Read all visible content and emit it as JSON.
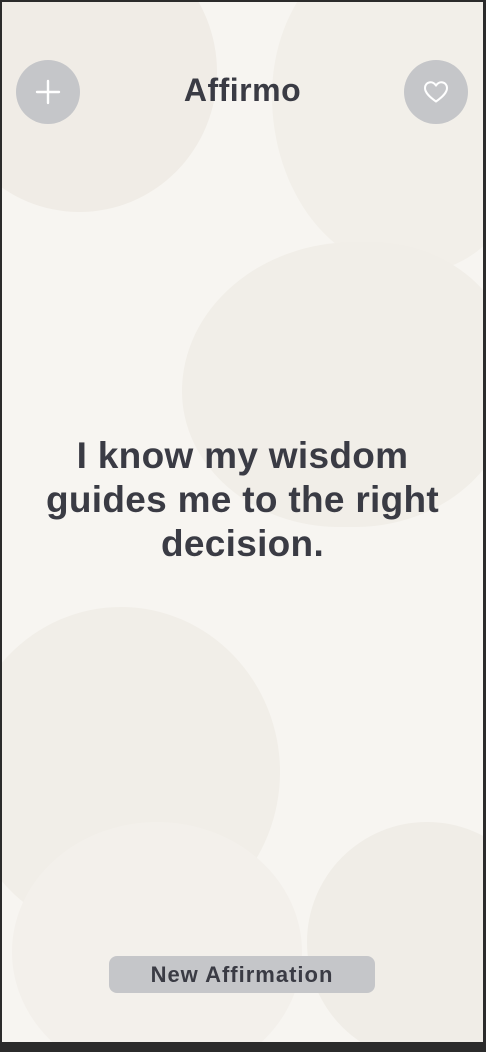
{
  "app": {
    "title": "Affirmo"
  },
  "header": {
    "add_icon": "plus-icon",
    "favorites_icon": "heart-icon"
  },
  "main": {
    "affirmation_text": "I know my wisdom guides me to the right decision."
  },
  "footer": {
    "new_button_label": "New Affirmation"
  },
  "colors": {
    "background": "#f7f5f1",
    "button": "#c5c6c9",
    "text": "#3a3b44"
  }
}
